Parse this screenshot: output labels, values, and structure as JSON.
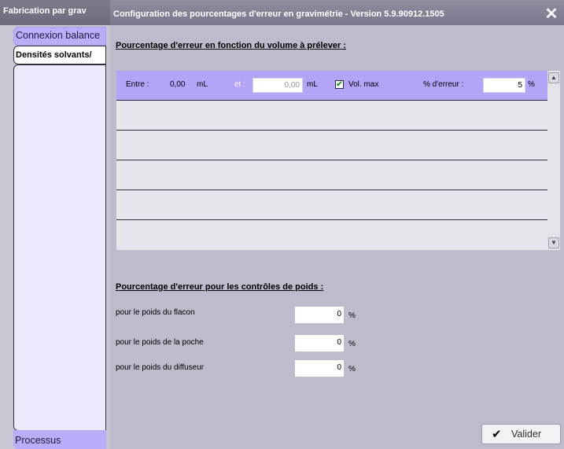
{
  "background_app": {
    "title": "Fabrication par grav"
  },
  "left_tabs": {
    "connexion": "Connexion balance",
    "densites": "Densités solvants/",
    "processus": "Processus"
  },
  "dialog": {
    "title": "Configuration des pourcentages d'erreur en gravimétrie - Version 5.9.90912.1505",
    "close_icon": "close-icon"
  },
  "volume_section": {
    "title": "Pourcentage d'erreur en fonction du volume à prélever :",
    "rows": [
      {
        "label_entre": "Entre :",
        "from_value": "0,00",
        "from_unit": "mL",
        "label_et": "et :",
        "to_value": "0,00",
        "to_unit": "mL",
        "checkbox_label": "Vol. max",
        "checkbox_checked": true,
        "label_pct": "% d'erreur :",
        "pct_value": "5",
        "pct_unit": "%"
      }
    ],
    "empty_rows": 4
  },
  "weight_section": {
    "title": "Pourcentage d'erreur pour les contrôles de poids :",
    "items": [
      {
        "label": "pour le poids du flacon",
        "value": "0",
        "unit": "%"
      },
      {
        "label": "pour le poids de la poche",
        "value": "0",
        "unit": "%"
      },
      {
        "label": "pour le poids du diffuseur",
        "value": "0",
        "unit": "%"
      }
    ]
  },
  "buttons": {
    "validate_label": "Valider",
    "validate_icon": "checkmark-icon"
  },
  "colors": {
    "accent_purple": "#b3a4f8",
    "tab_light": "#ecebfe"
  }
}
